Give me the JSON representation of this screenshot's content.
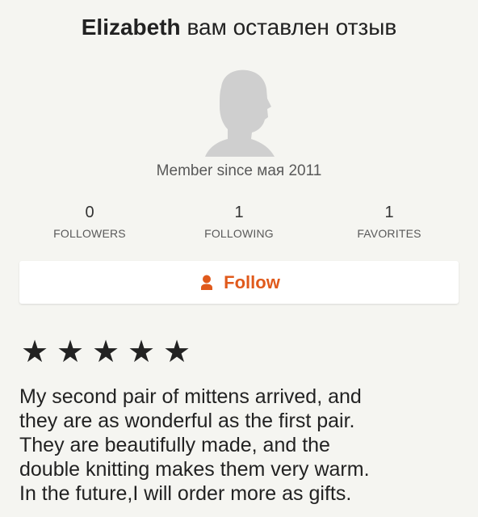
{
  "header": {
    "name": "Elizabeth",
    "suffix": "вам оставлен отзыв"
  },
  "profile": {
    "avatar_icon": "default-user-silhouette",
    "member_since": "Member since мая 2011"
  },
  "stats": [
    {
      "count": "0",
      "label": "FOLLOWERS"
    },
    {
      "count": "1",
      "label": "FOLLOWING"
    },
    {
      "count": "1",
      "label": "FAVORITES"
    }
  ],
  "follow": {
    "label": "Follow",
    "icon": "person-icon",
    "color": "#e05a1c"
  },
  "review": {
    "rating": 5,
    "rating_max": 5,
    "star_glyph": "★",
    "lines": [
      "My second pair of mittens arrived, and",
      "they are as wonderful as the first pair.",
      "They are beautifully made, and the",
      "double knitting makes them very warm.",
      "In the future,I  will order more as gifts."
    ]
  }
}
